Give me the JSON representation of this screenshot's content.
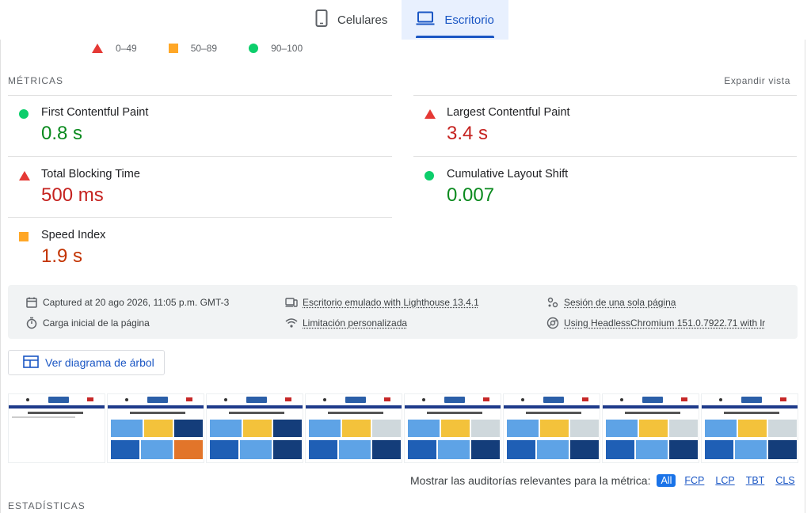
{
  "device_tabs": [
    {
      "label": "Celulares",
      "icon": "mobile-phone-icon",
      "active": false
    },
    {
      "label": "Escritorio",
      "icon": "laptop-icon",
      "active": true
    }
  ],
  "legend": {
    "fail": "0–49",
    "average": "50–89",
    "pass": "90–100"
  },
  "metrics_section": {
    "title": "MÉTRICAS",
    "expand_label": "Expandir vista",
    "items": [
      {
        "label": "First Contentful Paint",
        "value": "0.8 s",
        "rating": "pass"
      },
      {
        "label": "Largest Contentful Paint",
        "value": "3.4 s",
        "rating": "fail"
      },
      {
        "label": "Total Blocking Time",
        "value": "500 ms",
        "rating": "fail"
      },
      {
        "label": "Cumulative Layout Shift",
        "value": "0.007",
        "rating": "pass"
      },
      {
        "label": "Speed Index",
        "value": "1.9 s",
        "rating": "average"
      }
    ]
  },
  "run_info": {
    "captured": "Captured at 20 ago 2026, 11:05 p.m. GMT-3",
    "emulation": "Escritorio emulado with Lighthouse 13.4.1",
    "session": "Sesión de una sola página",
    "load": "Carga inicial de la página",
    "throttling": "Limitación personalizada",
    "browser": "Using HeadlessChromium 151.0.7922.71 with lr"
  },
  "tree_button": {
    "label": "Ver diagrama de árbol"
  },
  "audit_filter": {
    "label": "Mostrar las auditorías relevantes para la métrica:",
    "options": [
      "All",
      "FCP",
      "LCP",
      "TBT",
      "CLS"
    ],
    "active": "All"
  },
  "stats_title": "ESTADÍSTICAS",
  "colors": {
    "accent": "#1a56c4",
    "pass": "#0cce6b",
    "average": "#ffa726",
    "fail": "#e53935"
  }
}
